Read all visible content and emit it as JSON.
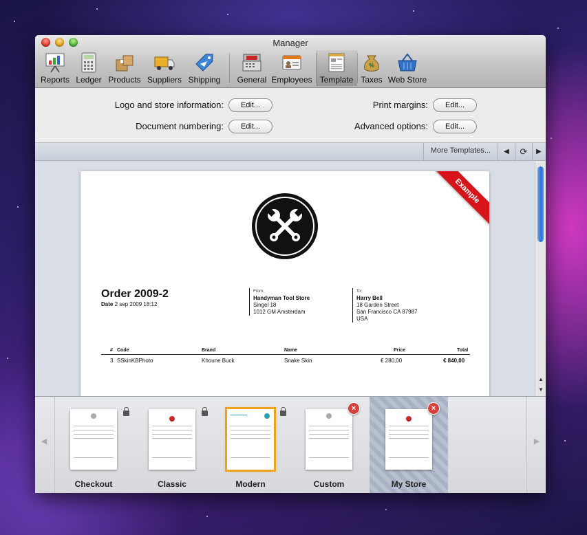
{
  "window": {
    "title": "Manager"
  },
  "toolbar": {
    "items": [
      {
        "label": "Reports",
        "icon": "presentation-chart-icon"
      },
      {
        "label": "Ledger",
        "icon": "calculator-icon"
      },
      {
        "label": "Products",
        "icon": "boxes-icon"
      },
      {
        "label": "Suppliers",
        "icon": "truck-icon"
      },
      {
        "label": "Shipping",
        "icon": "airplane-tag-icon"
      },
      {
        "label": "General",
        "icon": "cash-register-icon"
      },
      {
        "label": "Employees",
        "icon": "id-badge-icon"
      },
      {
        "label": "Template",
        "icon": "template-layout-icon"
      },
      {
        "label": "Taxes",
        "icon": "money-bag-icon"
      },
      {
        "label": "Web Store",
        "icon": "shopping-basket-icon"
      }
    ],
    "selected": "Template"
  },
  "settings": {
    "logo_label": "Logo and store information:",
    "numbering_label": "Document numbering:",
    "margins_label": "Print margins:",
    "advanced_label": "Advanced options:",
    "edit_label": "Edit..."
  },
  "subbar": {
    "more_templates": "More Templates...",
    "prev": "◀",
    "refresh": "⟳",
    "next": "▶"
  },
  "document": {
    "ribbon": "Example",
    "title": "Order 2009-2",
    "date_label": "Date",
    "date_value": "2 sep 2009 18:12",
    "from": {
      "label": "From:",
      "name": "Handyman Tool Store",
      "line1": "Singel 18",
      "line2": "1012 GM Amsterdam"
    },
    "to": {
      "label": "To:",
      "name": "Harry Bell",
      "line1": "18 Garden Street",
      "line2": "San Francisco CA 87987",
      "line3": "USA"
    },
    "table": {
      "headers": {
        "num": "#",
        "code": "Code",
        "brand": "Brand",
        "name": "Name",
        "price": "Price",
        "total": "Total"
      },
      "rows": [
        {
          "num": "3",
          "code": "SSkinKBPhoto",
          "brand": "Khoune Buck",
          "name": "Snake Skin",
          "price": "€ 280,00",
          "total": "€ 840,00"
        }
      ]
    }
  },
  "templates": {
    "items": [
      {
        "name": "Checkout",
        "locked": true,
        "deletable": false
      },
      {
        "name": "Classic",
        "locked": true,
        "deletable": false
      },
      {
        "name": "Modern",
        "locked": true,
        "deletable": false,
        "highlighted": true
      },
      {
        "name": "Custom",
        "locked": false,
        "deletable": true
      },
      {
        "name": "My Store",
        "locked": false,
        "deletable": true,
        "selected": true
      }
    ],
    "delete_symbol": "×",
    "prev": "◀",
    "next": "▶"
  },
  "colors": {
    "ribbon": "#d8141b",
    "highlight": "#f0a21c",
    "accent_blue": "#2d6fd6"
  }
}
